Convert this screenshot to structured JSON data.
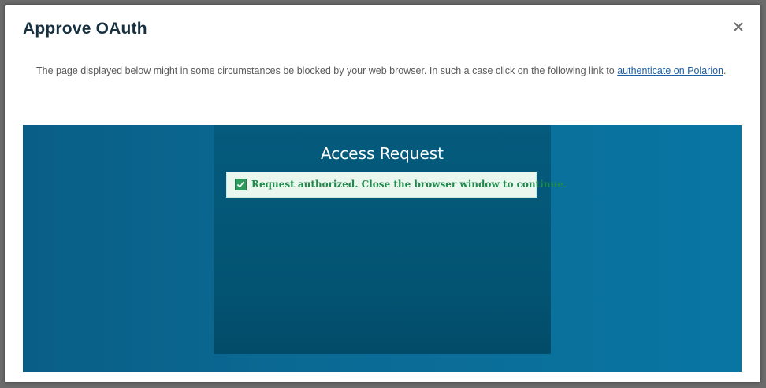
{
  "dialog": {
    "title": "Approve OAuth",
    "close_icon": "close-icon",
    "info_text_before": "The page displayed below might in some circumstances be blocked by your web browser. In such a case click on the following link to ",
    "info_link_label": "authenticate on Polarion",
    "info_text_after": "."
  },
  "embedded_page": {
    "title": "Access Request",
    "status_icon": "checkbox-checked-icon",
    "status_message": "Request authorized. Close the browser window to continue."
  },
  "colors": {
    "frame_background": "#0a6a94",
    "panel_background": "#035473",
    "success_background": "#e9f7ef",
    "success_text": "#1e8a4c",
    "link": "#1a5fa6"
  }
}
